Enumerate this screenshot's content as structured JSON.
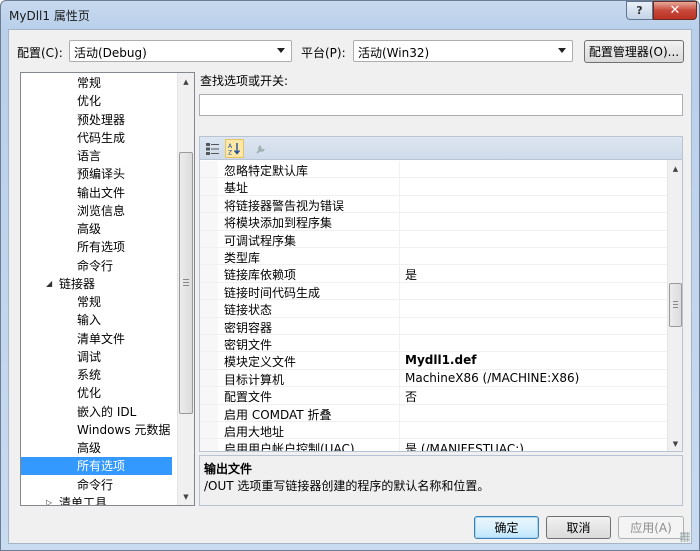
{
  "window": {
    "title": "MyDll1 属性页",
    "help_label": "?",
    "close_label": "✕"
  },
  "header": {
    "config_label": "配置(C):",
    "config_value": "活动(Debug)",
    "platform_label": "平台(P):",
    "platform_value": "活动(Win32)",
    "config_manager_label": "配置管理器(O)..."
  },
  "tree": {
    "items": [
      {
        "label": "常规",
        "level": 2
      },
      {
        "label": "优化",
        "level": 2
      },
      {
        "label": "预处理器",
        "level": 2
      },
      {
        "label": "代码生成",
        "level": 2
      },
      {
        "label": "语言",
        "level": 2
      },
      {
        "label": "预编译头",
        "level": 2
      },
      {
        "label": "输出文件",
        "level": 2
      },
      {
        "label": "浏览信息",
        "level": 2
      },
      {
        "label": "高级",
        "level": 2
      },
      {
        "label": "所有选项",
        "level": 2
      },
      {
        "label": "命令行",
        "level": 2
      },
      {
        "label": "链接器",
        "level": 1,
        "expanded": true
      },
      {
        "label": "常规",
        "level": 2
      },
      {
        "label": "输入",
        "level": 2
      },
      {
        "label": "清单文件",
        "level": 2
      },
      {
        "label": "调试",
        "level": 2
      },
      {
        "label": "系统",
        "level": 2
      },
      {
        "label": "优化",
        "level": 2
      },
      {
        "label": "嵌入的 IDL",
        "level": 2
      },
      {
        "label": "Windows 元数据",
        "level": 2
      },
      {
        "label": "高级",
        "level": 2
      },
      {
        "label": "所有选项",
        "level": 2,
        "selected": true
      },
      {
        "label": "命令行",
        "level": 2
      },
      {
        "label": "清单工具",
        "level": 1,
        "expanded": false
      }
    ]
  },
  "search": {
    "label": "查找选项或开关:",
    "value": ""
  },
  "grid": {
    "rows": [
      {
        "name": "忽略特定默认库",
        "value": ""
      },
      {
        "name": "基址",
        "value": ""
      },
      {
        "name": "将链接器警告视为错误",
        "value": ""
      },
      {
        "name": "将模块添加到程序集",
        "value": ""
      },
      {
        "name": "可调试程序集",
        "value": ""
      },
      {
        "name": "类型库",
        "value": ""
      },
      {
        "name": "链接库依赖项",
        "value": "是"
      },
      {
        "name": "链接时间代码生成",
        "value": ""
      },
      {
        "name": "链接状态",
        "value": ""
      },
      {
        "name": "密钥容器",
        "value": ""
      },
      {
        "name": "密钥文件",
        "value": ""
      },
      {
        "name": "模块定义文件",
        "value": "Mydll1.def",
        "bold": true
      },
      {
        "name": "目标计算机",
        "value": "MachineX86 (/MACHINE:X86)"
      },
      {
        "name": "配置文件",
        "value": "否"
      },
      {
        "name": "启用 COMDAT 折叠",
        "value": ""
      },
      {
        "name": "启用大地址",
        "value": ""
      },
      {
        "name": "启用用户帐户控制(UAC)",
        "value": "是 (/MANIFESTUAC:)"
      }
    ]
  },
  "description": {
    "title": "输出文件",
    "text": "/OUT 选项重写链接器创建的程序的默认名称和位置。"
  },
  "footer": {
    "ok_label": "确定",
    "cancel_label": "取消",
    "apply_label": "应用(A)"
  }
}
